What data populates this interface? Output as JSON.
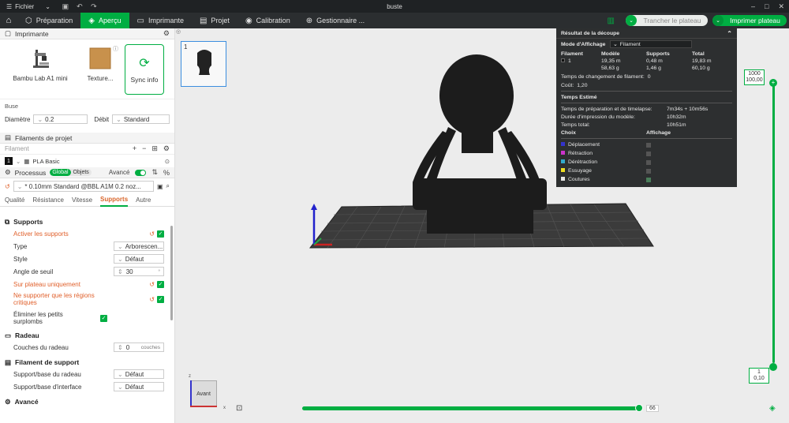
{
  "titlebar": {
    "menu_label": "Fichier",
    "title": "buste"
  },
  "nav": {
    "tabs": [
      {
        "label": "Préparation"
      },
      {
        "label": "Aperçu"
      },
      {
        "label": "Imprimante"
      },
      {
        "label": "Projet"
      },
      {
        "label": "Calibration"
      },
      {
        "label": "Gestionnaire ..."
      }
    ],
    "slice_label": "Trancher le plateau",
    "print_label": "Imprimer plateau"
  },
  "printer": {
    "section_title": "Imprimante",
    "printer_name": "Bambu Lab A1 mini",
    "plate_name": "Texture...",
    "sync_label": "Sync info",
    "nozzle_title": "Buse",
    "diameter_label": "Diamètre",
    "diameter_value": "0.2",
    "flow_label": "Débit",
    "flow_value": "Standard"
  },
  "filaments": {
    "section_title": "Filaments de projet",
    "filter_label": "Filament",
    "items": [
      {
        "num": "1",
        "name": "PLA Basic"
      }
    ]
  },
  "process": {
    "section_title": "Processus",
    "pill_global": "Global",
    "pill_objects": "Objets",
    "advanced_label": "Avancé",
    "preset": "* 0.10mm Standard @BBL A1M 0.2 noz...",
    "tabs": [
      "Qualité",
      "Résistance",
      "Vitesse",
      "Supports",
      "Autre"
    ],
    "active_tab": "Supports"
  },
  "settings": {
    "supports_group": "Supports",
    "enable_supports": "Activer les supports",
    "type_label": "Type",
    "type_value": "Arborescen...",
    "style_label": "Style",
    "style_value": "Défaut",
    "threshold_label": "Angle de seuil",
    "threshold_value": "30",
    "threshold_unit": "°",
    "on_plate_label": "Sur plateau uniquement",
    "critical_label": "Ne supporter que les régions critiques",
    "small_overhang_label": "Éliminer les petits surplombs",
    "raft_group": "Radeau",
    "raft_layers_label": "Couches du radeau",
    "raft_layers_value": "0",
    "raft_layers_unit": "couches",
    "support_filament_group": "Filament de support",
    "support_base_label": "Support/base du radeau",
    "support_base_value": "Défaut",
    "support_interface_label": "Support/base d'interface",
    "support_interface_value": "Défaut",
    "advanced_group": "Avancé"
  },
  "viewport": {
    "plate_number": "1",
    "view_label": "Avant",
    "axis_x": "x",
    "axis_z": "z",
    "layer_top_value": "1000",
    "layer_top_height": "100,00",
    "layer_bottom_value": "1",
    "layer_bottom_height": "0,10",
    "move_value": "66"
  },
  "result": {
    "title": "Résultat de la découpe",
    "display_mode_label": "Mode d'Affichage",
    "display_mode_value": "Filament",
    "col_filament": "Filament",
    "col_model": "Modèle",
    "col_supports": "Supports",
    "col_total": "Total",
    "row_num": "1",
    "model_m": "19,35 m",
    "model_g": "58,63 g",
    "supports_m": "0,48 m",
    "supports_g": "1,46 g",
    "total_m": "19,83 m",
    "total_g": "60,10 g",
    "change_time_label": "Temps de changement de filament:",
    "change_time_value": "0",
    "cost_label": "Coût:",
    "cost_value": "1,20",
    "estimated_title": "Temps Estimé",
    "prep_label": "Temps de préparation et de timelapse:",
    "prep_value": "7m34s + 10m56s",
    "print_label": "Durée d'impression du modèle:",
    "print_value": "10h32m",
    "total_label": "Temps total:",
    "total_value": "10h51m",
    "choice_label": "Choix",
    "display_label": "Affichage",
    "choices": [
      {
        "name": "Déplacement",
        "color": "#3333cc",
        "on": false
      },
      {
        "name": "Rétraction",
        "color": "#cc33cc",
        "on": false
      },
      {
        "name": "Dérétraction",
        "color": "#33aacc",
        "on": false
      },
      {
        "name": "Essuyage",
        "color": "#eedd22",
        "on": false
      },
      {
        "name": "Coutures",
        "color": "#e6e6e6",
        "on": true
      }
    ]
  },
  "colors": {
    "accent": "#00ae42",
    "orange": "#e05f2a",
    "dark": "#2d2f30"
  }
}
